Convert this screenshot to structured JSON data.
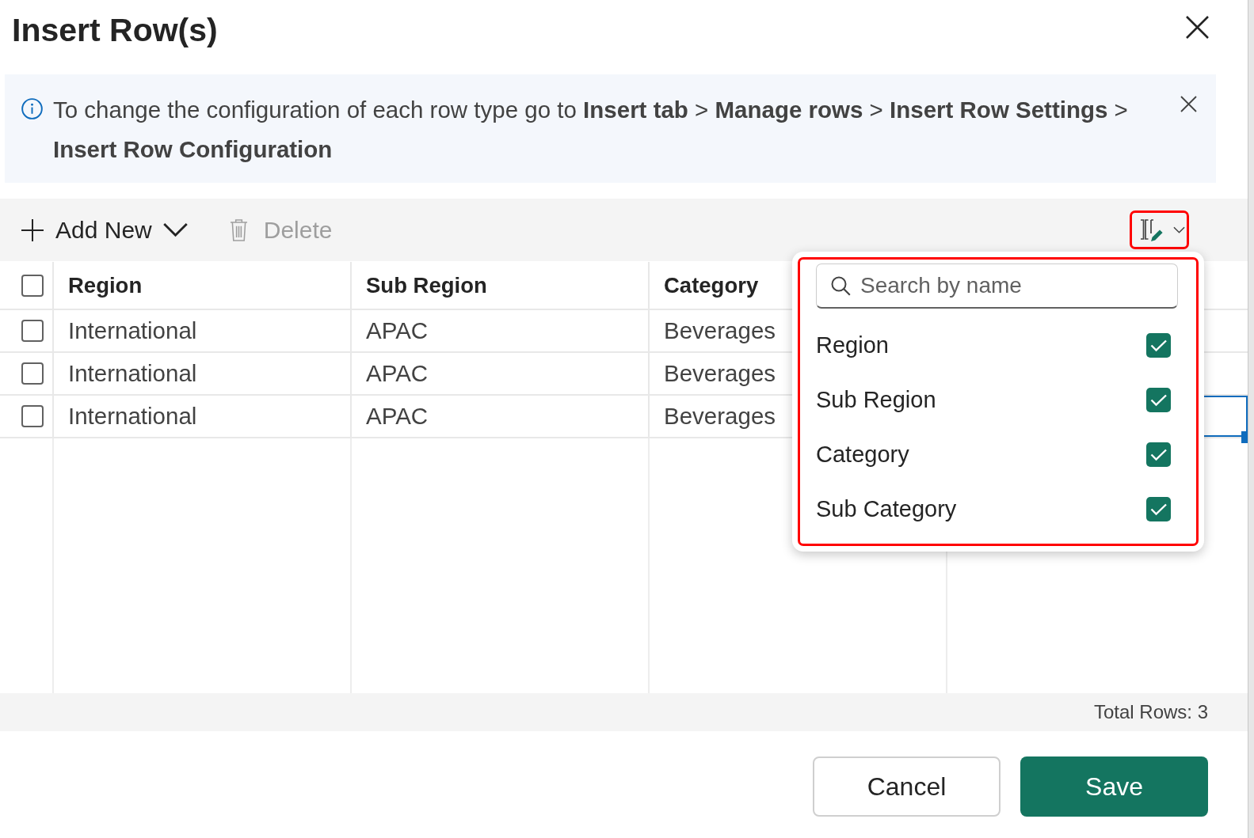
{
  "dialog": {
    "title": "Insert Row(s)"
  },
  "info_bar": {
    "message": "To change the configuration of each row type go to **Insert tab** > **Manage rows** > **Insert Row Settings** > **Insert Row Configuration**"
  },
  "toolbar": {
    "add_new": {
      "label": "Add New"
    },
    "delete": {
      "label": "Delete",
      "disabled": true
    },
    "column_chooser": {
      "expanded": true,
      "highlighted": true
    }
  },
  "table": {
    "select_all": {
      "checked": false
    },
    "columns": [
      "Region",
      "Sub Region",
      "Category"
    ],
    "rows": [
      {
        "checked": false,
        "focused": false,
        "cells": [
          "International",
          "APAC",
          "Beverages"
        ]
      },
      {
        "checked": false,
        "focused": false,
        "cells": [
          "International",
          "APAC",
          "Beverages"
        ]
      },
      {
        "checked": false,
        "focused": true,
        "cells": [
          "International",
          "APAC",
          "Beverages"
        ]
      }
    ]
  },
  "column_menu": {
    "highlighted": true,
    "search": {
      "placeholder": "Search by name"
    },
    "items": [
      {
        "label": "Region",
        "checked": true
      },
      {
        "label": "Sub Region",
        "checked": true
      },
      {
        "label": "Category",
        "checked": true
      },
      {
        "label": "Sub Category",
        "checked": true
      }
    ]
  },
  "footer": {
    "total_rows": "Total Rows: 3"
  },
  "buttons": [
    {
      "label": "Cancel",
      "kind": "secondary"
    },
    {
      "label": "Save",
      "kind": "primary"
    }
  ]
}
